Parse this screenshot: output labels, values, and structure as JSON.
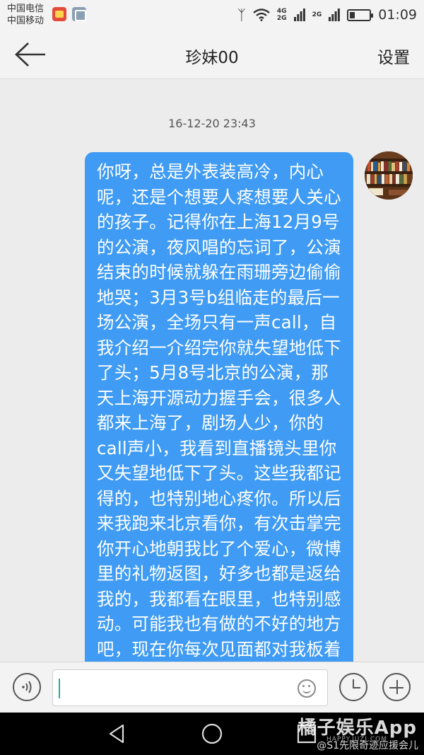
{
  "status_bar": {
    "carrier_1": "中国电信",
    "carrier_2": "中国移动",
    "net_1_top": "4G",
    "net_1_bottom": "2G",
    "net_2": "2G",
    "time": "01:09",
    "battery_level": 0.25
  },
  "header": {
    "title": "珍妹00",
    "settings_label": "设置"
  },
  "conversation": {
    "timestamp": "16-12-20 23:43",
    "message": "你呀，总是外表装高冷，内心呢，还是个想要人疼想要人关心的孩子。记得你在上海12月9号的公演，夜风唱的忘词了，公演结束的时候就躲在雨珊旁边偷偷地哭；3月3号b组临走的最后一场公演，全场只有一声call，自我介绍一介绍完你就失望地低下了头；5月8号北京的公演，那天上海开源动力握手会，很多人都来上海了，剧场人少，你的call声小，我看到直播镜头里你又失望地低下了头。这些我都记得的，也特别地心疼你。所以后来我跑来北京看你，有次击掌完你开心地朝我比了个爱心，微博里的礼物返图，好多也都是返给我的，我都看在眼里，也特别感动。可能我也有做的不好的地方吧，现在你每次见面都对我板着张脸，也不知道"
  },
  "input_bar": {
    "placeholder": ""
  },
  "watermark": {
    "title": "橘子娱乐App",
    "url": "HAPPY.JUZI.COM",
    "handle": "@S1先限奇迹应援会儿"
  },
  "colors": {
    "bubble": "#3f9bf3",
    "background": "#ececec",
    "bar": "#f3f3f3"
  }
}
